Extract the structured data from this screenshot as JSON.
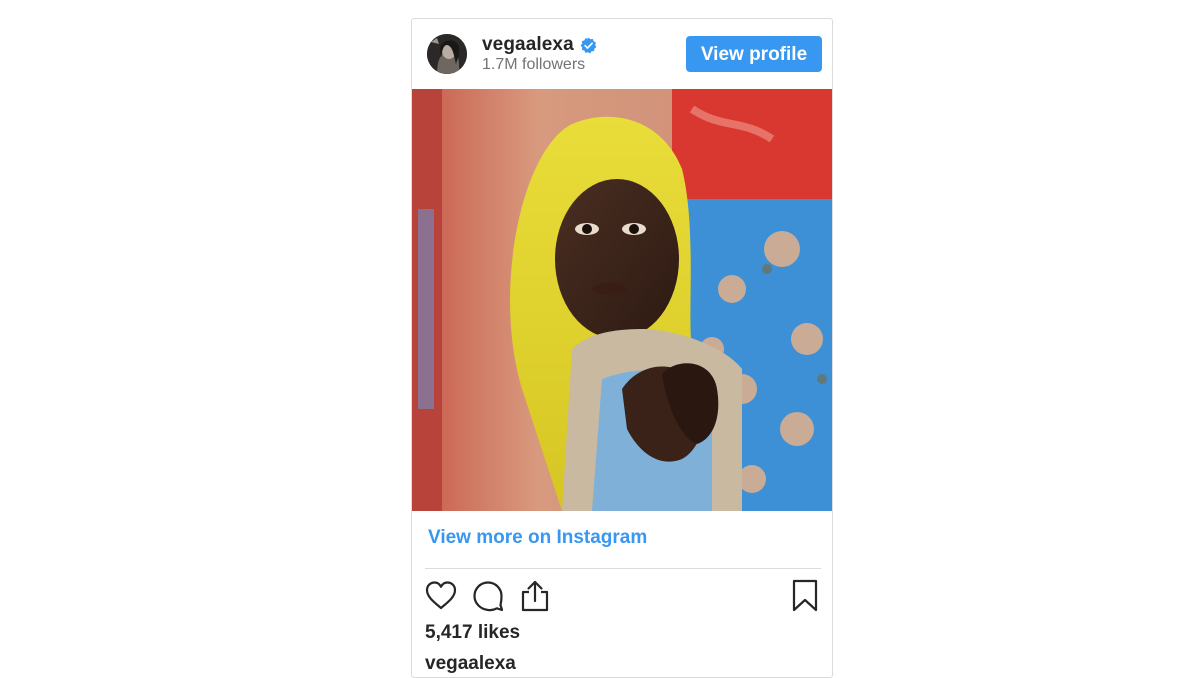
{
  "header": {
    "username": "vegaalexa",
    "followers": "1.7M followers",
    "view_profile_label": "View profile",
    "verified": true
  },
  "post": {
    "view_more_label": "View more on Instagram",
    "likes": "5,417 likes",
    "caption_user": "vegaalexa"
  },
  "icons": {
    "like": "heart-icon",
    "comment": "comment-icon",
    "share": "share-icon",
    "save": "bookmark-icon",
    "verified": "verified-badge-icon"
  },
  "colors": {
    "accent": "#3897f0",
    "text": "#262626",
    "secondary_text": "#737373",
    "border": "#dbdbdb"
  }
}
